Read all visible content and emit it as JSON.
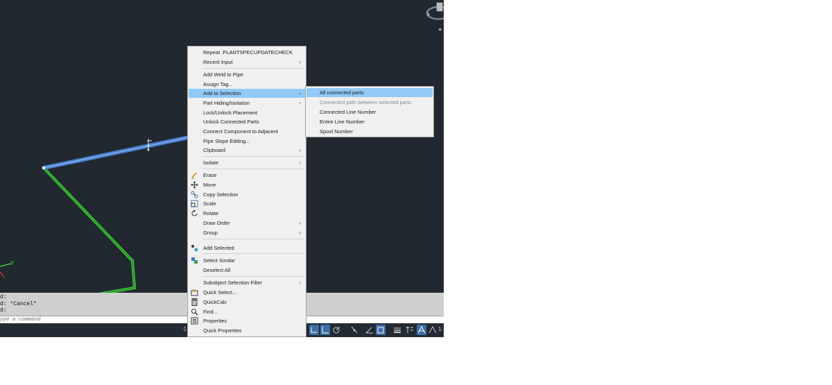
{
  "command_history": [
    "d:",
    "d: *Cancel*",
    "d:"
  ],
  "command_line": {
    "placeholder": "ype a command"
  },
  "context_menu": {
    "items": [
      {
        "label": "Repeat .PLANTSPECUPDATECHECK"
      },
      {
        "label": "Recent Input",
        "submenu": true
      },
      {
        "label": "Add Weld to Pipe"
      },
      {
        "label": "Assign Tag..."
      },
      {
        "label": "Add to Selection",
        "submenu": true,
        "highlighted": true
      },
      {
        "label": "Part Hiding/Isolation",
        "submenu": true
      },
      {
        "label": "Lock/Unlock Placement"
      },
      {
        "label": "Unlock Connected Parts"
      },
      {
        "label": "Connect Component to Adjacent"
      },
      {
        "label": "Pipe Slope Editing..."
      },
      {
        "label": "Clipboard",
        "submenu": true
      },
      {
        "label": "Isolate",
        "submenu": true
      },
      {
        "label": "Erase",
        "icon": "eraser-icon"
      },
      {
        "label": "Move",
        "icon": "move-icon"
      },
      {
        "label": "Copy Selection",
        "icon": "copy-icon"
      },
      {
        "label": "Scale",
        "icon": "scale-icon"
      },
      {
        "label": "Rotate",
        "icon": "rotate-icon"
      },
      {
        "label": "Draw Order",
        "submenu": true
      },
      {
        "label": "Group",
        "submenu": true
      },
      {
        "label": "Add Selected",
        "icon": "add-selected-icon"
      },
      {
        "label": "Select Similar",
        "icon": "select-similar-icon"
      },
      {
        "label": "Deselect All"
      },
      {
        "label": "Subobject Selection Filter",
        "submenu": true
      },
      {
        "label": "Quick Select...",
        "icon": "quick-select-icon"
      },
      {
        "label": "QuickCalc",
        "icon": "calculator-icon"
      },
      {
        "label": "Find...",
        "icon": "find-icon"
      },
      {
        "label": "Properties",
        "icon": "properties-icon"
      },
      {
        "label": "Quick Properties"
      }
    ],
    "arrow": "›"
  },
  "submenu": {
    "items": [
      {
        "label": "All connected parts",
        "highlighted": true
      },
      {
        "label": "Connected path between selected parts",
        "disabled": true
      },
      {
        "label": "Connected Line Number"
      },
      {
        "label": "Entire Line Number"
      },
      {
        "label": "Spool Number"
      }
    ]
  },
  "viewport": {
    "ucs_y_label": "Y",
    "compass_label": "S",
    "scale_label": "1:",
    "status_left": "-1"
  },
  "colors": {
    "background": "#212830",
    "pipe_selected": "#4a7fd0",
    "pipe": "#3fcf3a",
    "highlight": "#91c9f7"
  }
}
